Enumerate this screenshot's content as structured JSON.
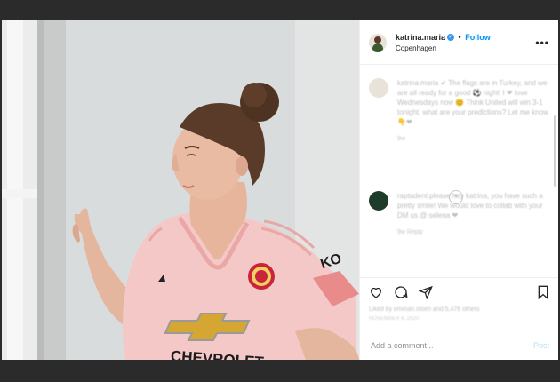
{
  "post": {
    "username": "katrina.maria",
    "verified": true,
    "separator": "•",
    "follow_label": "Follow",
    "location": "Copenhagen",
    "more_label": "•••"
  },
  "caption": {
    "text": "katrina.maria ✔ The flags are in Turkey, and we are all ready for a good ⚽ night! I ❤ love Wednesdays now 😊 Think United will win 3-1 tonight, what are your predictions? Let me know 👇❤",
    "time": "9w"
  },
  "load_more_label": "+",
  "comments": [
    {
      "text": "raptadent please hey katrina, you have such a pretty smile! We would love to collab with your DM us @ selena ❤",
      "time": "9w   Reply"
    }
  ],
  "likes_text": "Liked by emmah.olsen and 5,478 others",
  "date_text": "NOVEMBER 4, 2020",
  "add_comment": {
    "placeholder": "Add a comment...",
    "post_label": "Post"
  },
  "jersey": {
    "sponsor": "CHEVROLET",
    "sleeve_text": "KO"
  },
  "colors": {
    "accent": "#0095f6",
    "jersey_pink": "#f3c8c6",
    "overlay_bg": "#2b2b2b"
  }
}
